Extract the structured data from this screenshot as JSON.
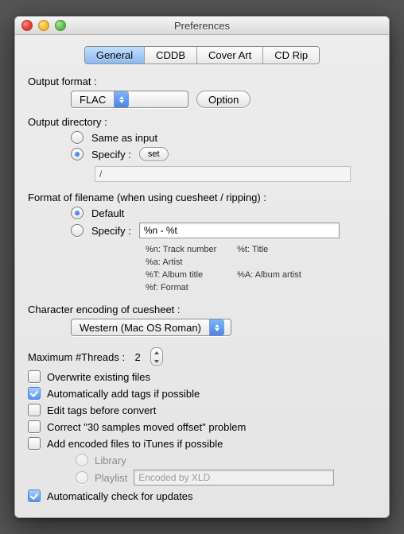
{
  "window": {
    "title": "Preferences"
  },
  "tabs": {
    "general": "General",
    "cddb": "CDDB",
    "cover_art": "Cover Art",
    "cd_rip": "CD Rip"
  },
  "output_format": {
    "label": "Output format :",
    "value": "FLAC",
    "option_btn": "Option"
  },
  "output_dir": {
    "label": "Output directory :",
    "same": "Same as input",
    "specify": "Specify :",
    "set_btn": "set",
    "path": "/"
  },
  "filename_fmt": {
    "label": "Format of filename (when using cuesheet / ripping) :",
    "default": "Default",
    "specify": "Specify :",
    "pattern": "%n - %t",
    "legend_n": "%n: Track number",
    "legend_t": "%t: Title",
    "legend_a": "%a: Artist",
    "legend_T": "%T: Album title",
    "legend_A": "%A: Album artist",
    "legend_f": "%f: Format"
  },
  "encoding": {
    "label": "Character encoding of cuesheet :",
    "value": "Western (Mac OS Roman)"
  },
  "threads": {
    "label": "Maximum #Threads :",
    "value": "2"
  },
  "opts": {
    "overwrite": "Overwrite existing files",
    "auto_tags": "Automatically add tags if possible",
    "edit_tags": "Edit tags before convert",
    "correct30": "Correct \"30 samples moved offset\" problem",
    "to_itunes": "Add encoded files to iTunes if possible",
    "library": "Library",
    "playlist": "Playlist",
    "playlist_placeholder": "Encoded by XLD",
    "check_updates": "Automatically check for updates"
  }
}
